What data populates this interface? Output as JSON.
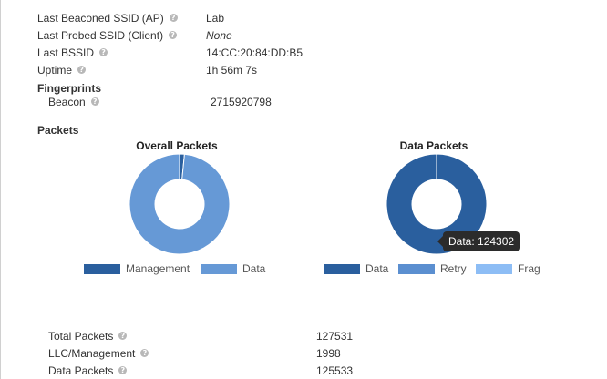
{
  "info": {
    "rows": [
      {
        "label": "Last Beaconed SSID (AP)",
        "value": "Lab",
        "italic": false
      },
      {
        "label": "Last Probed SSID (Client)",
        "value": "None",
        "italic": true
      },
      {
        "label": "Last BSSID",
        "value": "14:CC:20:84:DD:B5",
        "italic": false
      },
      {
        "label": "Uptime",
        "value": "1h 56m 7s",
        "italic": false
      }
    ],
    "fingerprints_heading": "Fingerprints",
    "beacon": {
      "label": "Beacon",
      "value": "2715920798"
    }
  },
  "packets_heading": "Packets",
  "help_glyph": "?",
  "colors": {
    "management": "#2a5f9e",
    "data": "#6699d6",
    "retry": "#5b8fd0",
    "frag": "#8dbdf5",
    "tooltip_bg": "#2b2b2b"
  },
  "chart_data": [
    {
      "type": "pie",
      "title": "Overall Packets",
      "donut": true,
      "categories": [
        "Management",
        "Data"
      ],
      "values": [
        1998,
        125533
      ],
      "colors": [
        "#2a5f9e",
        "#6699d6"
      ],
      "legend_position": "bottom"
    },
    {
      "type": "pie",
      "title": "Data Packets",
      "donut": true,
      "categories": [
        "Data",
        "Retry",
        "Frag"
      ],
      "values": [
        124302,
        0,
        0
      ],
      "colors": [
        "#2a5f9e",
        "#5b8fd0",
        "#8dbdf5"
      ],
      "legend_position": "bottom",
      "tooltip": "Data: 124302"
    }
  ],
  "summary": {
    "rows": [
      {
        "label": "Total Packets",
        "value": "127531"
      },
      {
        "label": "LLC/Management",
        "value": "1998"
      },
      {
        "label": "Data Packets",
        "value": "125533"
      }
    ]
  }
}
